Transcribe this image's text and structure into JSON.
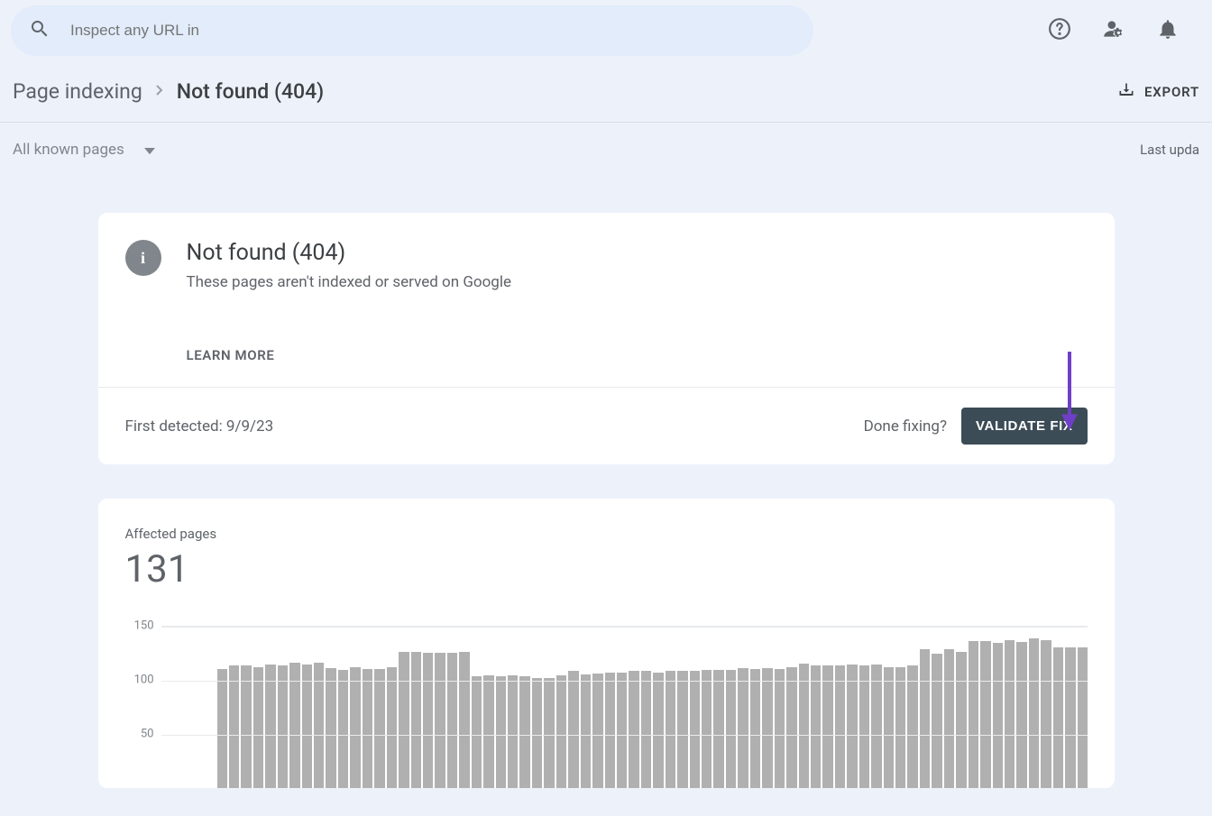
{
  "search": {
    "placeholder": "Inspect any URL in"
  },
  "breadcrumb": {
    "parent": "Page indexing",
    "current": "Not found (404)"
  },
  "export_label": "EXPORT",
  "filter": {
    "label": "All known pages"
  },
  "last_updated_label": "Last upda",
  "info_card": {
    "title": "Not found (404)",
    "subtitle": "These pages aren't indexed or served on Google",
    "learn_more": "LEARN MORE",
    "first_detected_label": "First detected: 9/9/23",
    "done_fixing_label": "Done fixing?",
    "validate_label": "VALIDATE FIX"
  },
  "affected": {
    "label": "Affected pages",
    "count": "131"
  },
  "chart_data": {
    "type": "bar",
    "title": "Affected pages",
    "ylabel": "",
    "xlabel": "",
    "ylim": [
      0,
      150
    ],
    "yticks": [
      50,
      100,
      150
    ],
    "values": [
      110,
      113,
      113,
      112,
      114,
      113,
      116,
      114,
      116,
      111,
      109,
      112,
      110,
      110,
      112,
      126,
      126,
      125,
      125,
      125,
      126,
      103,
      104,
      103,
      104,
      103,
      102,
      102,
      104,
      108,
      105,
      106,
      107,
      107,
      108,
      108,
      107,
      108,
      108,
      108,
      109,
      109,
      109,
      111,
      110,
      111,
      110,
      112,
      115,
      113,
      113,
      113,
      114,
      113,
      114,
      112,
      112,
      113,
      128,
      124,
      128,
      126,
      136,
      136,
      134,
      137,
      135,
      138,
      137,
      130,
      130,
      130
    ]
  }
}
